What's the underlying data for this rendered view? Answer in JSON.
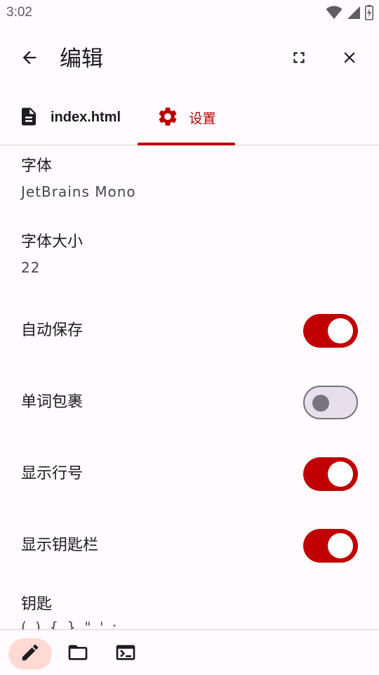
{
  "status_bar": {
    "time": "3:02",
    "icons": [
      "wifi-icon",
      "signal-icon",
      "battery-charging-icon"
    ]
  },
  "app_bar": {
    "title": "编辑",
    "back_icon": "arrow-back-icon",
    "fullscreen_icon": "fullscreen-icon",
    "close_icon": "close-icon"
  },
  "tabs": [
    {
      "label": "index.html",
      "icon": "document-icon",
      "selected": false
    },
    {
      "label": "设置",
      "icon": "gear-icon",
      "selected": true
    }
  ],
  "settings": {
    "font": {
      "label": "字体",
      "value": "JetBrains Mono"
    },
    "font_size": {
      "label": "字体大小",
      "value": "22"
    },
    "auto_save": {
      "label": "自动保存",
      "enabled": true
    },
    "word_wrap": {
      "label": "单词包裹",
      "enabled": false
    },
    "show_line_numbers": {
      "label": "显示行号",
      "enabled": true
    },
    "show_keys_bar": {
      "label": "显示钥匙栏",
      "enabled": true
    },
    "keys": {
      "label": "钥匙",
      "value_clipped": "( ) { } \" ' ;"
    }
  },
  "bottom_nav": [
    {
      "name": "edit",
      "icon": "pencil-icon",
      "selected": true
    },
    {
      "name": "files",
      "icon": "folder-icon",
      "selected": false
    },
    {
      "name": "terminal",
      "icon": "terminal-icon",
      "selected": false
    }
  ],
  "colors": {
    "accent": "#c00000",
    "background": "#fffbfe",
    "selected_nav_bg": "#ffdad4",
    "switch_off_track": "#e7e0ec",
    "switch_off_outline": "#79747e"
  }
}
